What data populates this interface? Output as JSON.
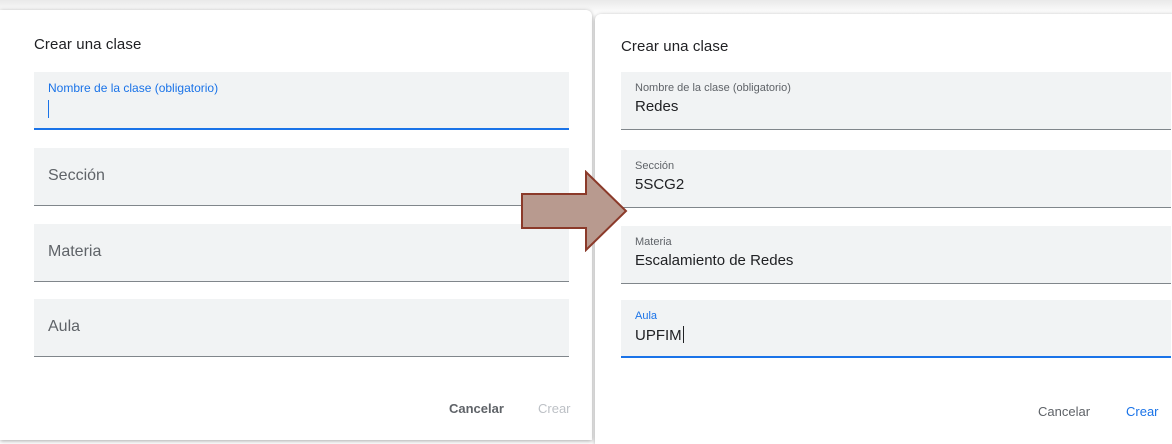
{
  "left_dialog": {
    "title": "Crear una clase",
    "fields": [
      {
        "label": "Nombre de la clase (obligatorio)",
        "value": "",
        "state": "focused"
      },
      {
        "label": "Sección",
        "value": "",
        "state": "empty"
      },
      {
        "label": "Materia",
        "value": "",
        "state": "empty"
      },
      {
        "label": "Aula",
        "value": "",
        "state": "empty"
      }
    ],
    "buttons": {
      "cancel": "Cancelar",
      "create": "Crear",
      "create_state": "disabled"
    }
  },
  "right_dialog": {
    "title": "Crear una clase",
    "fields": [
      {
        "label": "Nombre de la clase (obligatorio)",
        "value": "Redes",
        "state": "filled"
      },
      {
        "label": "Sección",
        "value": "5SCG2",
        "state": "filled"
      },
      {
        "label": "Materia",
        "value": "Escalamiento de Redes",
        "state": "filled"
      },
      {
        "label": "Aula",
        "value": "UPFIM",
        "state": "focused"
      }
    ],
    "buttons": {
      "cancel": "Cancelar",
      "create": "Crear",
      "create_state": "enabled"
    }
  },
  "colors": {
    "accent": "#1a73e8",
    "field_bg": "#f1f3f4",
    "arrow_fill": "#b89a8f",
    "arrow_stroke": "#8b3a2a"
  },
  "icons": {
    "transition": "right-arrow-icon"
  }
}
